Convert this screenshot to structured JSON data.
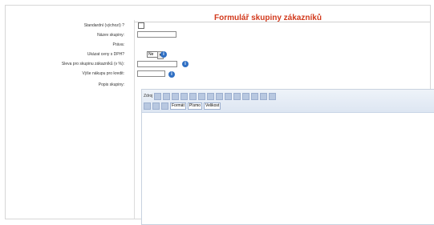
{
  "title": "Formulář skupiny zákazníků",
  "labels": {
    "standard": "Standardní (výchozí) ?",
    "name": "Název skupiny:",
    "rights": "Práva:",
    "vat": "Ukázat ceny s DPH?",
    "discount": "Sleva pro skupinu zákazníků (v %):",
    "minimum": "Výše nákupu pro kredit:",
    "description": "Popis skupiny:"
  },
  "vat_value": "Ne",
  "info_icon": "i",
  "toolbar": {
    "source": "Zdroj",
    "format": "Formát",
    "style": "Písmo",
    "size": "Velikost"
  }
}
